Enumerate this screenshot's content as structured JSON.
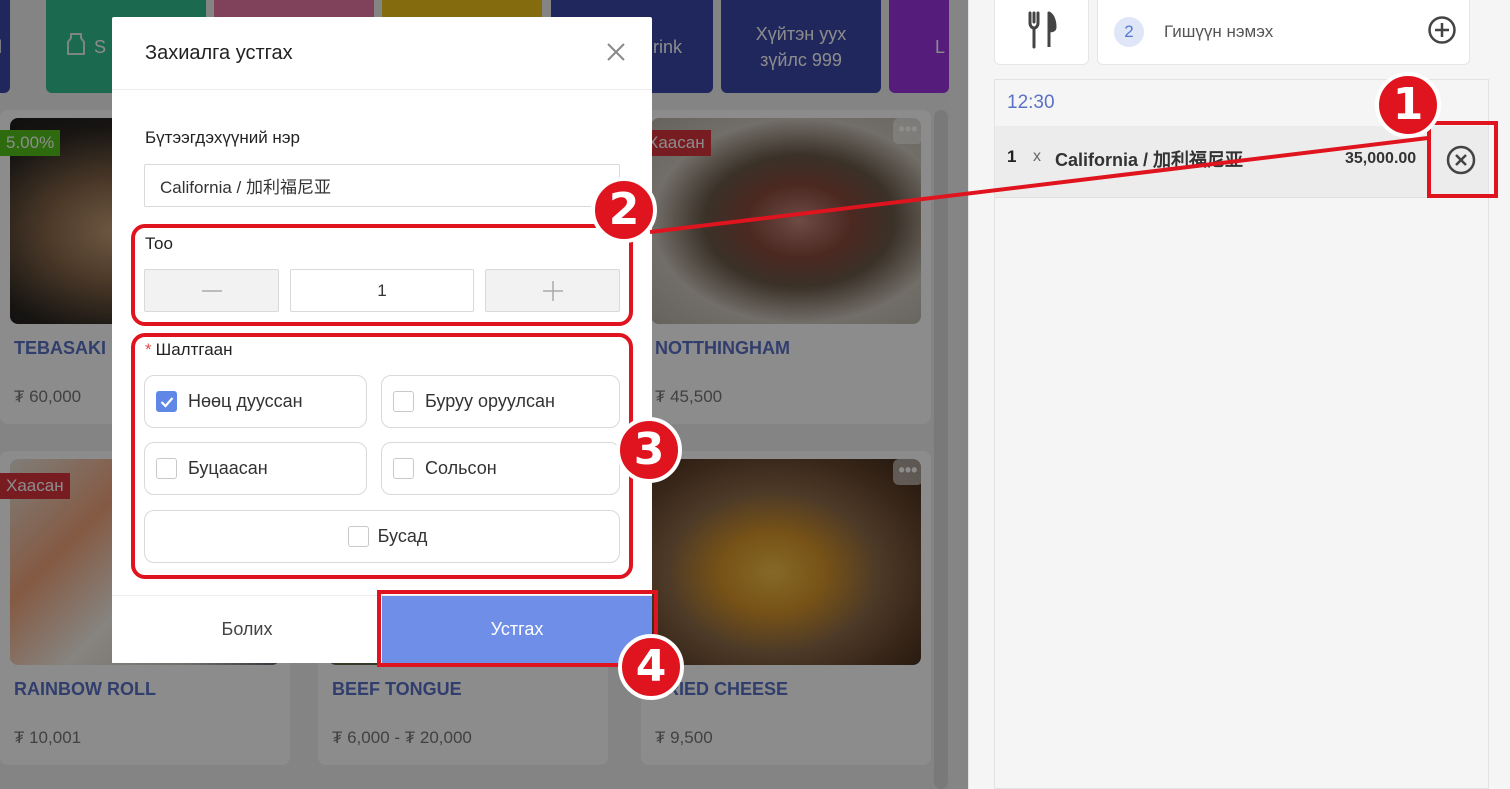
{
  "categories": [
    {
      "label": "l",
      "color": "#3b47a8"
    },
    {
      "label": "S",
      "color": "#32c08e"
    },
    {
      "label": "",
      "color": "#e879a4"
    },
    {
      "label": "",
      "color": "#f0c41b"
    },
    {
      "label": "rink",
      "color": "#3b47a8"
    },
    {
      "label": "Хүйтэн уух зүйлс 999",
      "color": "#3b47a8"
    },
    {
      "label": "L",
      "color": "#9b33e0"
    }
  ],
  "products": [
    {
      "name": "TEBASAKI",
      "price": "₮ 60,000",
      "badge": "5.00%"
    },
    {
      "name": "",
      "price": "",
      "badge": ""
    },
    {
      "name": "NOTTHINGHAM",
      "price": "₮ 45,500",
      "badge": "Хаасан"
    },
    {
      "name": "RAINBOW ROLL",
      "price": "₮ 10,001",
      "badge": "Хаасан"
    },
    {
      "name": "BEEF TONGUE",
      "price": "₮ 6,000 - ₮ 20,000",
      "badge": ""
    },
    {
      "name": "FRIED CHEESE",
      "price": "₮ 9,500",
      "badge": ""
    }
  ],
  "panel": {
    "guest_count": "2",
    "guest_add_label": "Гишүүн нэмэх",
    "order_time": "12:30",
    "order_item": {
      "qty": "1",
      "x": "x",
      "name": "California / 加利福尼亚",
      "price": "35,000.00"
    }
  },
  "modal": {
    "title": "Захиалга устгах",
    "product_label": "Бүтээгдэхүүний нэр",
    "product_value": "California / 加利福尼亚",
    "qty_label": "Тоо",
    "qty_value": "1",
    "reason_label": "Шалтгаан",
    "reasons": [
      {
        "label": "Нөөц дууссан",
        "checked": true
      },
      {
        "label": "Буруу оруулсан",
        "checked": false
      },
      {
        "label": "Буцаасан",
        "checked": false
      },
      {
        "label": "Сольсон",
        "checked": false
      },
      {
        "label": "Бусад",
        "checked": false
      }
    ],
    "cancel_label": "Болих",
    "confirm_label": "Устгах"
  },
  "annotations": [
    "1",
    "2",
    "3",
    "4"
  ],
  "colors": {
    "accent": "#6f8ee8",
    "annotation": "#e0141e",
    "link": "#5a72c6"
  }
}
